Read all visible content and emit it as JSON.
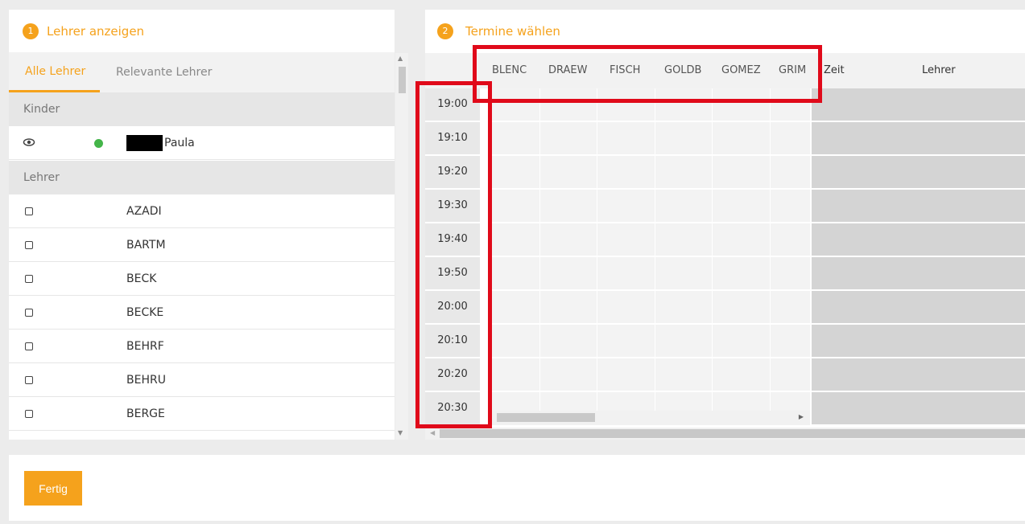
{
  "left_panel": {
    "step": "1",
    "title": "Lehrer anzeigen",
    "tabs": [
      "Alle Lehrer",
      "Relevante Lehrer"
    ],
    "group_children": "Kinder",
    "child_name": "Paula",
    "group_teachers": "Lehrer",
    "teachers": [
      "AZADI",
      "BARTM",
      "BECK",
      "BECKE",
      "BEHRF",
      "BEHRU",
      "BERGE"
    ]
  },
  "right_panel": {
    "step": "2",
    "title": "Termine wählen",
    "columns": [
      "BLENC",
      "DRAEW",
      "FISCH",
      "GOLDB",
      "GOMEZ",
      "GRIM"
    ],
    "zeit_header": "Zeit",
    "lehrer_header": "Lehrer",
    "times": [
      "19:00",
      "19:10",
      "19:20",
      "19:30",
      "19:40",
      "19:50",
      "20:00",
      "20:10",
      "20:20",
      "20:30"
    ]
  },
  "footer": {
    "done_label": "Fertig"
  },
  "colors": {
    "accent": "#f5a21c",
    "highlight": "#e00a1a",
    "status_online": "#44b549"
  },
  "icons": [
    "eye-icon",
    "checkbox-icon",
    "scroll-up-arrow-icon",
    "scroll-down-arrow-icon",
    "scroll-right-arrow-icon",
    "scroll-left-arrow-icon"
  ]
}
